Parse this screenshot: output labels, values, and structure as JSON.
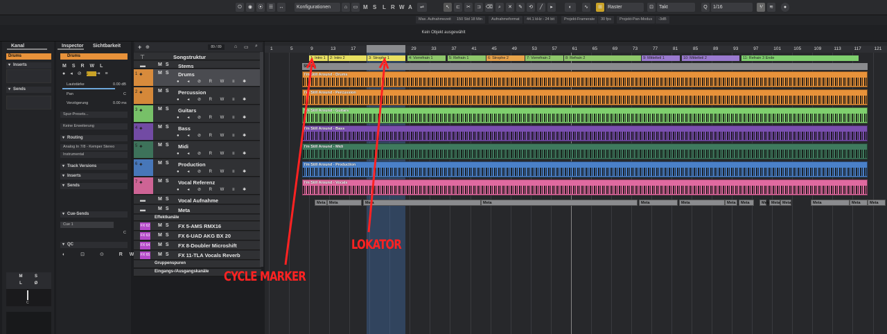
{
  "toolbar": {
    "preset": "Konfigurationen",
    "modes": [
      "M",
      "S",
      "L",
      "R",
      "W",
      "A"
    ],
    "snap": "Raster",
    "grid": "Takt",
    "quantize": "1/16"
  },
  "infobar": {
    "items": [
      "Max. Aufnahmezeit",
      "150 Std 18 Min",
      "Aufnahmeformat",
      "44.1 kHz - 24 bit",
      "Projekt-Framerate",
      "30 fps",
      "Projekt-Pan-Modus",
      "-3dB"
    ]
  },
  "selection": "Kein Objekt ausgewählt",
  "left": {
    "tab": "Kanal",
    "channel": "Drums",
    "inserts": "Inserts",
    "sends": "Sends",
    "btns": [
      "M",
      "S",
      "L",
      "Ø"
    ],
    "pan": "C"
  },
  "inspector": {
    "tabs": [
      "Inspector",
      "Sichtbarkeit"
    ],
    "track": "Drums",
    "vol_label": "Lautstärke",
    "vol_value": "0.00 dB",
    "pan_label": "Pan",
    "pan_value": "C",
    "delay_label": "Verzögerung",
    "delay_value": "0.00 ms",
    "preset": "Spur-Presets...",
    "ext": "Keine Erweiterung",
    "routing": "Routing",
    "in": "Analog In 7/8 - Kemper Stereo",
    "out": "Instrumental",
    "sections": [
      "Track Versions",
      "Inserts",
      "Sends",
      "Cue-Sends",
      "QC"
    ],
    "cue": "Cue 1",
    "cue_pan": "C",
    "btns": [
      "M",
      "S",
      "R",
      "W",
      "L"
    ]
  },
  "tracklist": {
    "count": "89 / 89",
    "tracks": [
      {
        "n": "",
        "name": "Songstruktur"
      },
      {
        "n": "",
        "name": "Stems"
      },
      {
        "n": "1",
        "name": "Drums"
      },
      {
        "n": "2",
        "name": "Percussion"
      },
      {
        "n": "3",
        "name": "Guitars"
      },
      {
        "n": "4",
        "name": "Bass"
      },
      {
        "n": "5",
        "name": "Midi"
      },
      {
        "n": "6",
        "name": "Production"
      },
      {
        "n": "7",
        "name": "Vocal Referenz"
      },
      {
        "n": "",
        "name": "Vocal Aufnahme"
      },
      {
        "n": "",
        "name": "Meta"
      },
      {
        "n": "",
        "name": "Effektkanäle"
      },
      {
        "n": "FX 62",
        "name": "FX 5-AMS RMX16"
      },
      {
        "n": "FX 63",
        "name": "FX 6-UAD AKG BX 20"
      },
      {
        "n": "FX 64",
        "name": "FX 8-Doubler Microshift"
      },
      {
        "n": "FX 65",
        "name": "FX 11-TLA Vocals Reverb"
      },
      {
        "n": "",
        "name": "Gruppenspuren"
      },
      {
        "n": "",
        "name": "Eingangs-/Ausgangskanäle"
      }
    ]
  },
  "ruler": [
    "1",
    "5",
    "9",
    "13",
    "17",
    "21",
    "25",
    "29",
    "33",
    "37",
    "41",
    "45",
    "49",
    "53",
    "57",
    "61",
    "65",
    "69",
    "73",
    "77",
    "81",
    "85",
    "89",
    "93",
    "97",
    "101",
    "105",
    "109",
    "113",
    "117",
    "121",
    "125"
  ],
  "markers": [
    "1: Intro 1",
    "2: Intro 2",
    "3: Strophe 1",
    "4: Vorrefrain 1",
    "5: Refrain 1",
    "6: Strophe 2",
    "7: Vorrefrain 2",
    "8: Refrain 2",
    "9: Mittelteil 1",
    "10: Mittelteil 2",
    "11: Refrain 3 Ende"
  ],
  "stems_label": "Stems",
  "clips": [
    "I'm Still Around - Drums",
    "I'm Still Around - Percussion",
    "I'm Still Around - Guitars",
    "I'm Still Around - Bass",
    "I'm Still Around - Midi",
    "I'm Still Around - Production",
    "I'm Still Around - Vocals"
  ],
  "meta": "Meta",
  "annotations": {
    "cycle": "CYCLE MARKER",
    "locator": "LOKATOR"
  },
  "colors": {
    "drums": "#e8923a",
    "perc": "#e8923a",
    "guitars": "#7fd06e",
    "bass": "#7a4fb0",
    "midi": "#3f7a5e",
    "production": "#4a80c8",
    "vocals": "#e06aa0",
    "annotation": "#ff2222"
  }
}
